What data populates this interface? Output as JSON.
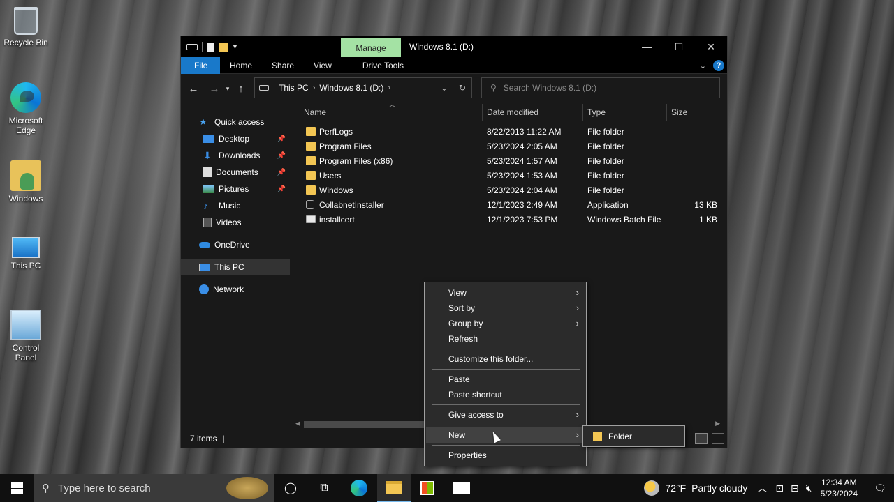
{
  "desktop": {
    "icons": [
      {
        "label": "Recycle Bin"
      },
      {
        "label": "Microsoft Edge"
      },
      {
        "label": "Windows"
      },
      {
        "label": "This PC"
      },
      {
        "label": "Control Panel"
      }
    ]
  },
  "window": {
    "manage_tab": "Manage",
    "title": "Windows 8.1 (D:)",
    "controls": {
      "minimize": "—",
      "maximize": "☐",
      "close": "✕"
    }
  },
  "ribbon": {
    "tabs": [
      "File",
      "Home",
      "Share",
      "View",
      "Drive Tools"
    ],
    "help": "?"
  },
  "address": {
    "crumbs": [
      "This PC",
      "Windows 8.1 (D:)"
    ],
    "search_placeholder": "Search Windows 8.1 (D:)"
  },
  "nav": {
    "items": [
      {
        "label": "Quick access",
        "icon": "star-icon",
        "pinned": false
      },
      {
        "label": "Desktop",
        "icon": "desktop-icon",
        "pinned": true
      },
      {
        "label": "Downloads",
        "icon": "download-icon",
        "pinned": true
      },
      {
        "label": "Documents",
        "icon": "documents-icon",
        "pinned": true
      },
      {
        "label": "Pictures",
        "icon": "pictures-icon",
        "pinned": true
      },
      {
        "label": "Music",
        "icon": "music-icon",
        "pinned": false
      },
      {
        "label": "Videos",
        "icon": "videos-icon",
        "pinned": false
      },
      {
        "label": "OneDrive",
        "icon": "cloud-icon",
        "pinned": false
      },
      {
        "label": "This PC",
        "icon": "computer-icon",
        "pinned": false
      },
      {
        "label": "Network",
        "icon": "network-icon",
        "pinned": false
      }
    ]
  },
  "columns": [
    "Name",
    "Date modified",
    "Type",
    "Size"
  ],
  "files": [
    {
      "name": "PerfLogs",
      "date": "8/22/2013 11:22 AM",
      "type": "File folder",
      "size": "",
      "kind": "folder"
    },
    {
      "name": "Program Files",
      "date": "5/23/2024 2:05 AM",
      "type": "File folder",
      "size": "",
      "kind": "folder"
    },
    {
      "name": "Program Files (x86)",
      "date": "5/23/2024 1:57 AM",
      "type": "File folder",
      "size": "",
      "kind": "folder"
    },
    {
      "name": "Users",
      "date": "5/23/2024 1:53 AM",
      "type": "File folder",
      "size": "",
      "kind": "folder"
    },
    {
      "name": "Windows",
      "date": "5/23/2024 2:04 AM",
      "type": "File folder",
      "size": "",
      "kind": "folder"
    },
    {
      "name": "CollabnetInstaller",
      "date": "12/1/2023 2:49 AM",
      "type": "Application",
      "size": "13 KB",
      "kind": "app"
    },
    {
      "name": "installcert",
      "date": "12/1/2023 7:53 PM",
      "type": "Windows Batch File",
      "size": "1 KB",
      "kind": "bat"
    }
  ],
  "status": {
    "count": "7 items"
  },
  "context_menu": {
    "items": [
      "View",
      "Sort by",
      "Group by",
      "Refresh",
      "Customize this folder...",
      "Paste",
      "Paste shortcut",
      "Give access to",
      "New",
      "Properties"
    ],
    "submenu_new": [
      "Folder"
    ]
  },
  "taskbar": {
    "search_placeholder": "Type here to search",
    "weather_temp": "72°F",
    "weather_desc": "Partly cloudy",
    "time": "12:34 AM",
    "date": "5/23/2024"
  }
}
